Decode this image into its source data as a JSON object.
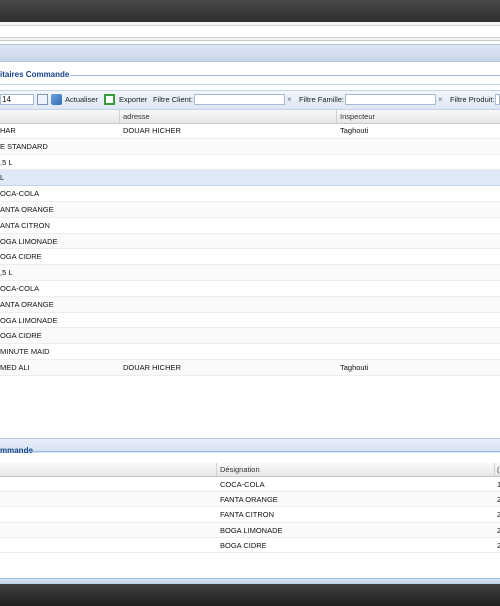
{
  "top_panel": {
    "title": "itaires Commande",
    "toolbar": {
      "input_value": "14",
      "refresh_label": "Actualiser",
      "export_label": "Exporter",
      "filter_client_label": "Filtre Client:",
      "filter_family_label": "Filtre Famille:",
      "filter_product_label": "Filtre Produit:",
      "clear_symbol": "×"
    },
    "columns": [
      "",
      "adresse",
      "Inspecteur"
    ],
    "rows": [
      {
        "name": "HAR",
        "address": "DOUAR HICHER",
        "inspector": "Taghouti"
      },
      {
        "name": "E STANDARD",
        "address": "",
        "inspector": ""
      },
      {
        "name": ".5 L",
        "address": "",
        "inspector": ""
      },
      {
        "name": " L",
        "address": "",
        "inspector": ""
      },
      {
        "name": "OCA-COLA",
        "address": "",
        "inspector": ""
      },
      {
        "name": "ANTA ORANGE",
        "address": "",
        "inspector": ""
      },
      {
        "name": "ANTA CITRON",
        "address": "",
        "inspector": ""
      },
      {
        "name": "OGA LIMONADE",
        "address": "",
        "inspector": ""
      },
      {
        "name": "OGA CIDRE",
        "address": "",
        "inspector": ""
      },
      {
        "name": ",5 L",
        "address": "",
        "inspector": ""
      },
      {
        "name": "OCA-COLA",
        "address": "",
        "inspector": ""
      },
      {
        "name": "ANTA ORANGE",
        "address": "",
        "inspector": ""
      },
      {
        "name": "OGA LIMONADE",
        "address": "",
        "inspector": ""
      },
      {
        "name": "OGA CIDRE",
        "address": "",
        "inspector": ""
      },
      {
        "name": "MINUTE MAID",
        "address": "",
        "inspector": ""
      },
      {
        "name": "MED ALI",
        "address": "DOUAR HICHER",
        "inspector": "Taghouti"
      }
    ]
  },
  "bottom_panel": {
    "title": "mmande",
    "columns": [
      "",
      "Désignation",
      "("
    ],
    "rows": [
      {
        "designation": "COCA-COLA",
        "qty": "1"
      },
      {
        "designation": "FANTA ORANGE",
        "qty": "2"
      },
      {
        "designation": "FANTA CITRON",
        "qty": "2"
      },
      {
        "designation": "BOGA LIMONADE",
        "qty": "2"
      },
      {
        "designation": "BOGA CIDRE",
        "qty": "2"
      }
    ]
  },
  "colors": {
    "accent": "#15428b",
    "header_band": "#c9d7ea",
    "selected_row": "#dfe8f6"
  }
}
